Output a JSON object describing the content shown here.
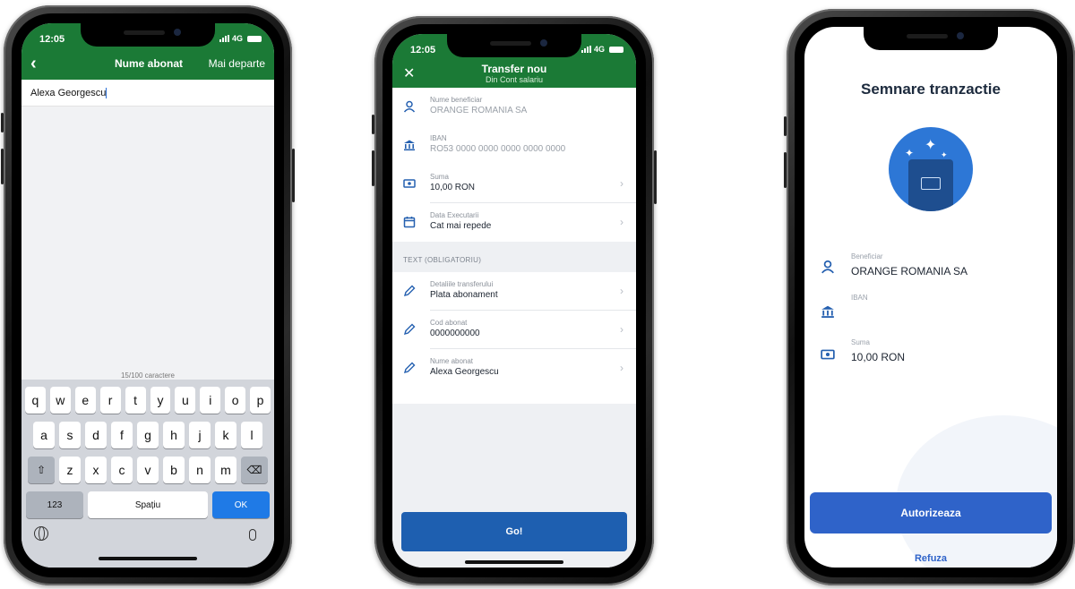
{
  "phone1": {
    "status": {
      "time": "12:05",
      "network": "4G"
    },
    "header": {
      "back_icon": "chevron-left-icon",
      "title": "Nume abonat",
      "next_label": "Mai departe"
    },
    "input_value": "Alexa Georgescu",
    "counter": "15/100 caractere",
    "keyboard": {
      "row1": [
        "q",
        "w",
        "e",
        "r",
        "t",
        "y",
        "u",
        "i",
        "o",
        "p"
      ],
      "row2": [
        "a",
        "s",
        "d",
        "f",
        "g",
        "h",
        "j",
        "k",
        "l"
      ],
      "row3": [
        "z",
        "x",
        "c",
        "v",
        "b",
        "n",
        "m"
      ],
      "num_label": "123",
      "space_label": "Spațiu",
      "ok_label": "OK"
    }
  },
  "phone2": {
    "status": {
      "time": "12:05",
      "network": "4G"
    },
    "header": {
      "title": "Transfer nou",
      "subtitle": "Din Cont salariu"
    },
    "rows": [
      {
        "label": "Nume beneficiar",
        "value": "ORANGE ROMANIA SA",
        "icon": "user-icon"
      },
      {
        "label": "IBAN",
        "value": "RO53 0000 0000 0000 0000 0000",
        "icon": "bank-icon"
      },
      {
        "label": "Suma",
        "value": "10,00 RON",
        "icon": "money-icon"
      },
      {
        "label": "Data Executarii",
        "value": "Cat mai repede",
        "icon": "calendar-icon"
      }
    ],
    "section_title": "TEXT (OBLIGATORIU)",
    "text_rows": [
      {
        "label": "Detaliile transferului",
        "value": "Plata abonament",
        "icon": "pencil-icon"
      },
      {
        "label": "Cod abonat",
        "value": "0000000000",
        "icon": "pencil-icon"
      },
      {
        "label": "Nume abonat",
        "value": "Alexa Georgescu",
        "icon": "pencil-icon"
      }
    ],
    "go_label": "Go!"
  },
  "phone3": {
    "title": "Semnare tranzactie",
    "items": [
      {
        "label": "Beneficiar",
        "value": "ORANGE ROMANIA SA",
        "icon": "user-icon"
      },
      {
        "label": "IBAN",
        "value": "",
        "icon": "bank-icon"
      },
      {
        "label": "Suma",
        "value": "10,00 RON",
        "icon": "money-icon"
      }
    ],
    "authorize_label": "Autorizeaza",
    "refuse_label": "Refuza"
  },
  "colors": {
    "header_green": "#1b7a36",
    "primary_blue": "#1e5fb0",
    "accent_blue": "#2f63c9"
  }
}
